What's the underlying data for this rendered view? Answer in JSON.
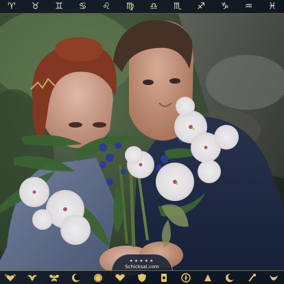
{
  "zodiac": [
    {
      "name": "aries",
      "glyph": "♈︎"
    },
    {
      "name": "taurus",
      "glyph": "♉︎"
    },
    {
      "name": "gemini",
      "glyph": "♊︎"
    },
    {
      "name": "cancer",
      "glyph": "♋︎"
    },
    {
      "name": "leo",
      "glyph": "♌︎"
    },
    {
      "name": "virgo",
      "glyph": "♍︎"
    },
    {
      "name": "libra",
      "glyph": "♎︎"
    },
    {
      "name": "scorpio",
      "glyph": "♏︎"
    },
    {
      "name": "sagittarius",
      "glyph": "♐︎"
    },
    {
      "name": "capricorn",
      "glyph": "♑︎"
    },
    {
      "name": "aquarius",
      "glyph": "♒︎"
    },
    {
      "name": "pisces",
      "glyph": "♓︎"
    }
  ],
  "bottom_icons": [
    {
      "name": "heart-wings-icon"
    },
    {
      "name": "bird-icon"
    },
    {
      "name": "butterfly-icon"
    },
    {
      "name": "moon-face-icon"
    },
    {
      "name": "lion-icon"
    },
    {
      "name": "love-icon"
    },
    {
      "name": "shield-icon"
    },
    {
      "name": "tarot-icon"
    },
    {
      "name": "compass-icon"
    },
    {
      "name": "crystal-ball-icon"
    },
    {
      "name": "moon-icon"
    },
    {
      "name": "stars-icon"
    },
    {
      "name": "wings-icon"
    }
  ],
  "brand": {
    "name": "Schicksal.com",
    "stars": "★★★★★"
  },
  "colors": {
    "accent": "#e6c36a",
    "bar_bg": "#0e1622"
  }
}
